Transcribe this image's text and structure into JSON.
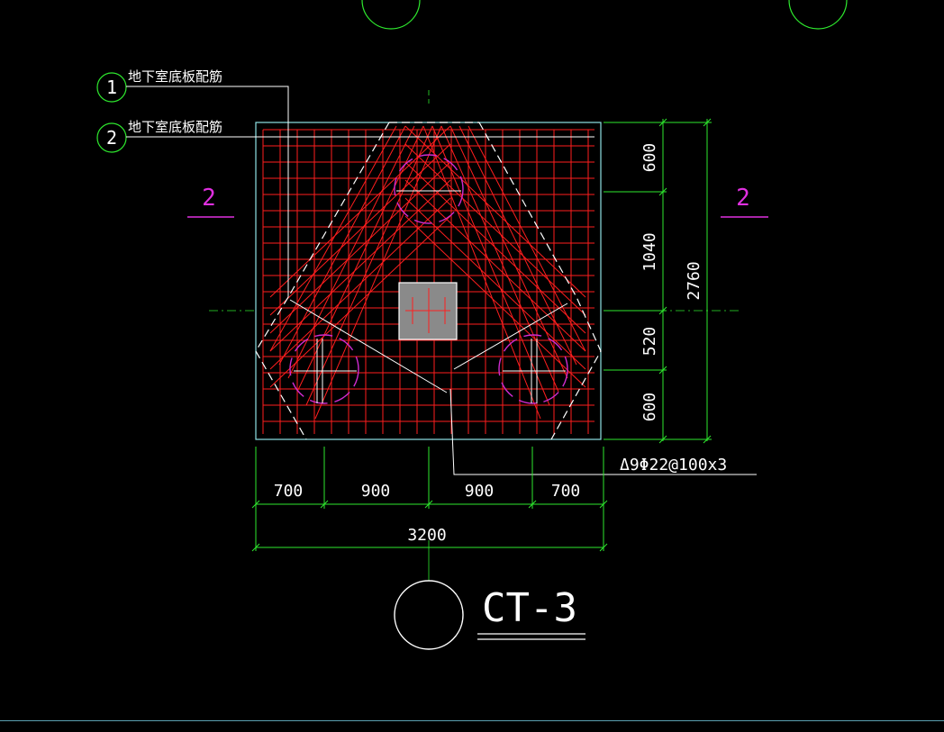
{
  "drawing": {
    "title": "CT-3",
    "callouts": [
      {
        "number": "1",
        "label": "地下室底板配筋"
      },
      {
        "number": "2",
        "label": "地下室底板配筋"
      }
    ],
    "section_marks": {
      "left": "2",
      "right": "2"
    },
    "rebar_note": "Δ9Φ22@100x3",
    "dims_bottom": [
      "700",
      "900",
      "900",
      "700"
    ],
    "dim_total_bottom": "3200",
    "dims_right": [
      "600",
      "1040",
      "520",
      "600"
    ],
    "dim_total_right": "2760"
  },
  "colors": {
    "background": "#000000",
    "rebar": "#ff1e1e",
    "outline": "#8fe3e6",
    "dimension": "#2ee82e",
    "section_mark": "#e030e0",
    "annotation": "#ffffff",
    "pile": "#d02bd0",
    "column": "#8a8a8a"
  }
}
